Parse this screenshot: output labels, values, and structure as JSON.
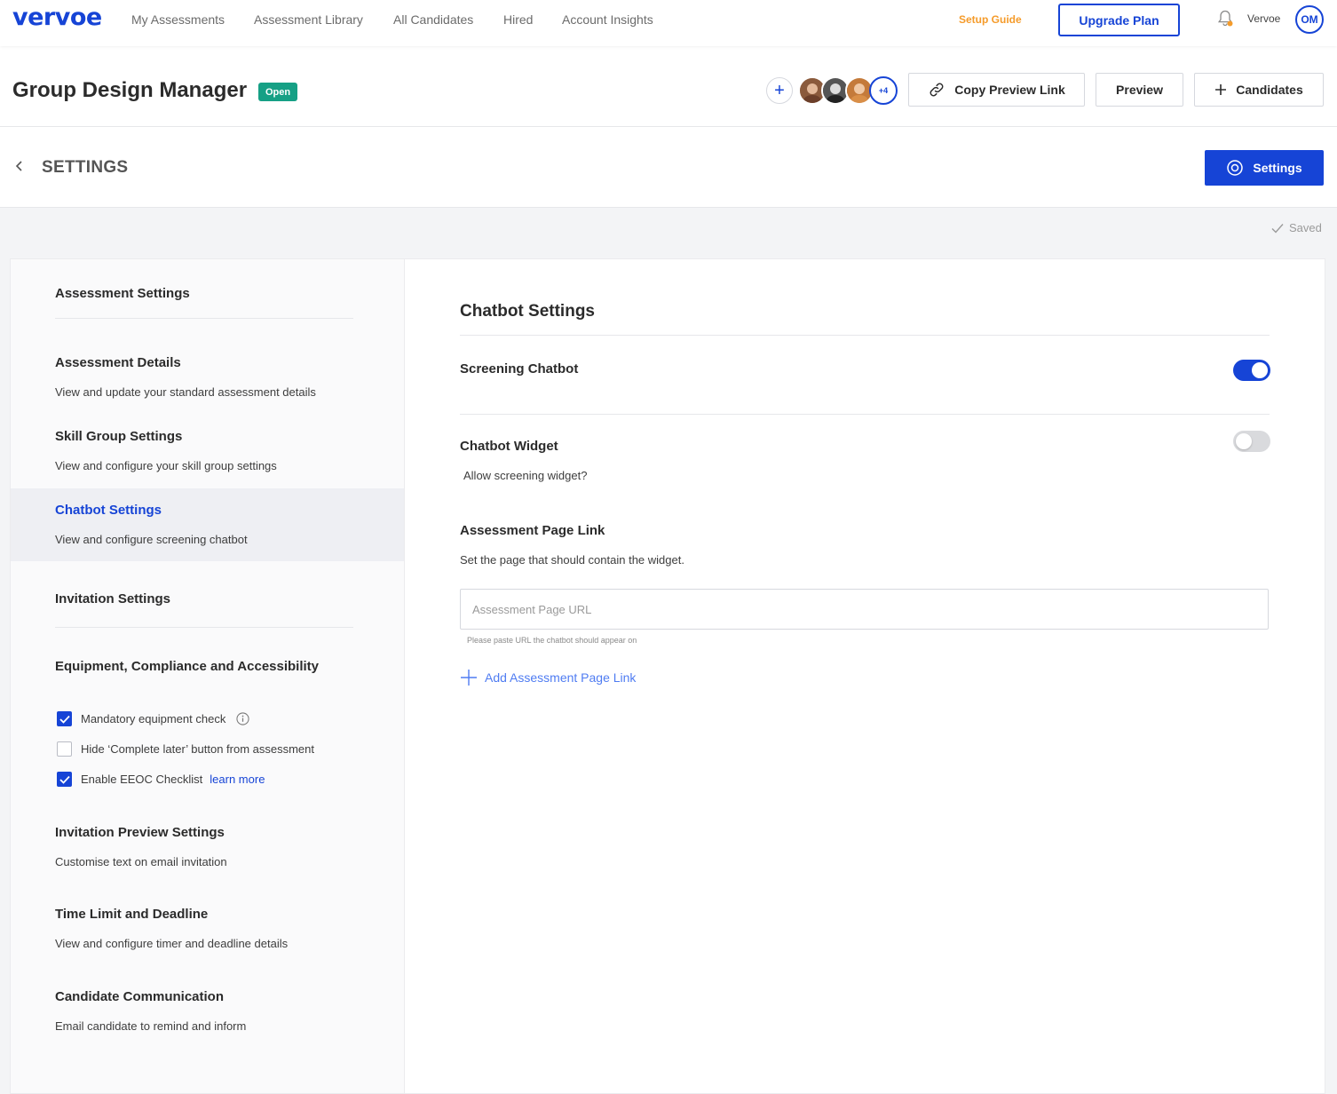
{
  "brand": {
    "logo": "vervoe",
    "accent": "#1644d6",
    "orange": "#f59b2a",
    "badge_green": "#16a085"
  },
  "topnav": {
    "links": [
      "My Assessments",
      "Assessment Library",
      "All Candidates",
      "Hired",
      "Account Insights"
    ],
    "setup_guide": "Setup Guide",
    "upgrade": "Upgrade Plan",
    "account_name": "Vervoe",
    "avatar_initials": "OM"
  },
  "header": {
    "title": "Group Design Manager",
    "status": "Open",
    "more_collaborators": "+4",
    "copy_preview_link": "Copy Preview Link",
    "preview": "Preview",
    "candidates": "Candidates"
  },
  "settings_bar": {
    "heading": "SETTINGS",
    "button": "Settings"
  },
  "saved_status": "Saved",
  "sidebar": {
    "assessment_settings": "Assessment Settings",
    "items": [
      {
        "title": "Assessment Details",
        "desc": "View and update your standard assessment details"
      },
      {
        "title": "Skill Group Settings",
        "desc": "View and configure your skill group settings"
      },
      {
        "title": "Chatbot Settings",
        "desc": "View and configure screening chatbot"
      }
    ],
    "invitation_settings": "Invitation Settings",
    "equipment": {
      "title": "Equipment, Compliance and Accessibility",
      "checks": [
        {
          "label": "Mandatory equipment check",
          "checked": true
        },
        {
          "label": "Hide ‘Complete later’ button from assessment",
          "checked": false
        },
        {
          "label": "Enable EEOC Checklist",
          "checked": true,
          "link": "learn more"
        }
      ]
    },
    "more_items": [
      {
        "title": "Invitation Preview Settings",
        "desc": "Customise text on email invitation"
      },
      {
        "title": "Time Limit and Deadline",
        "desc": "View and configure timer and deadline details"
      },
      {
        "title": "Candidate Communication",
        "desc": "Email candidate to remind and inform"
      }
    ]
  },
  "main": {
    "title": "Chatbot Settings",
    "screening_chatbot": {
      "label": "Screening Chatbot",
      "enabled": true
    },
    "chatbot_widget": {
      "label": "Chatbot Widget",
      "desc": "Allow screening widget?",
      "enabled": false
    },
    "page_link": {
      "label": "Assessment Page Link",
      "desc": "Set the page that should contain the widget.",
      "placeholder": "Assessment Page URL",
      "value": "",
      "helper": "Please paste URL the chatbot should appear on",
      "add": "Add Assessment Page Link"
    }
  }
}
